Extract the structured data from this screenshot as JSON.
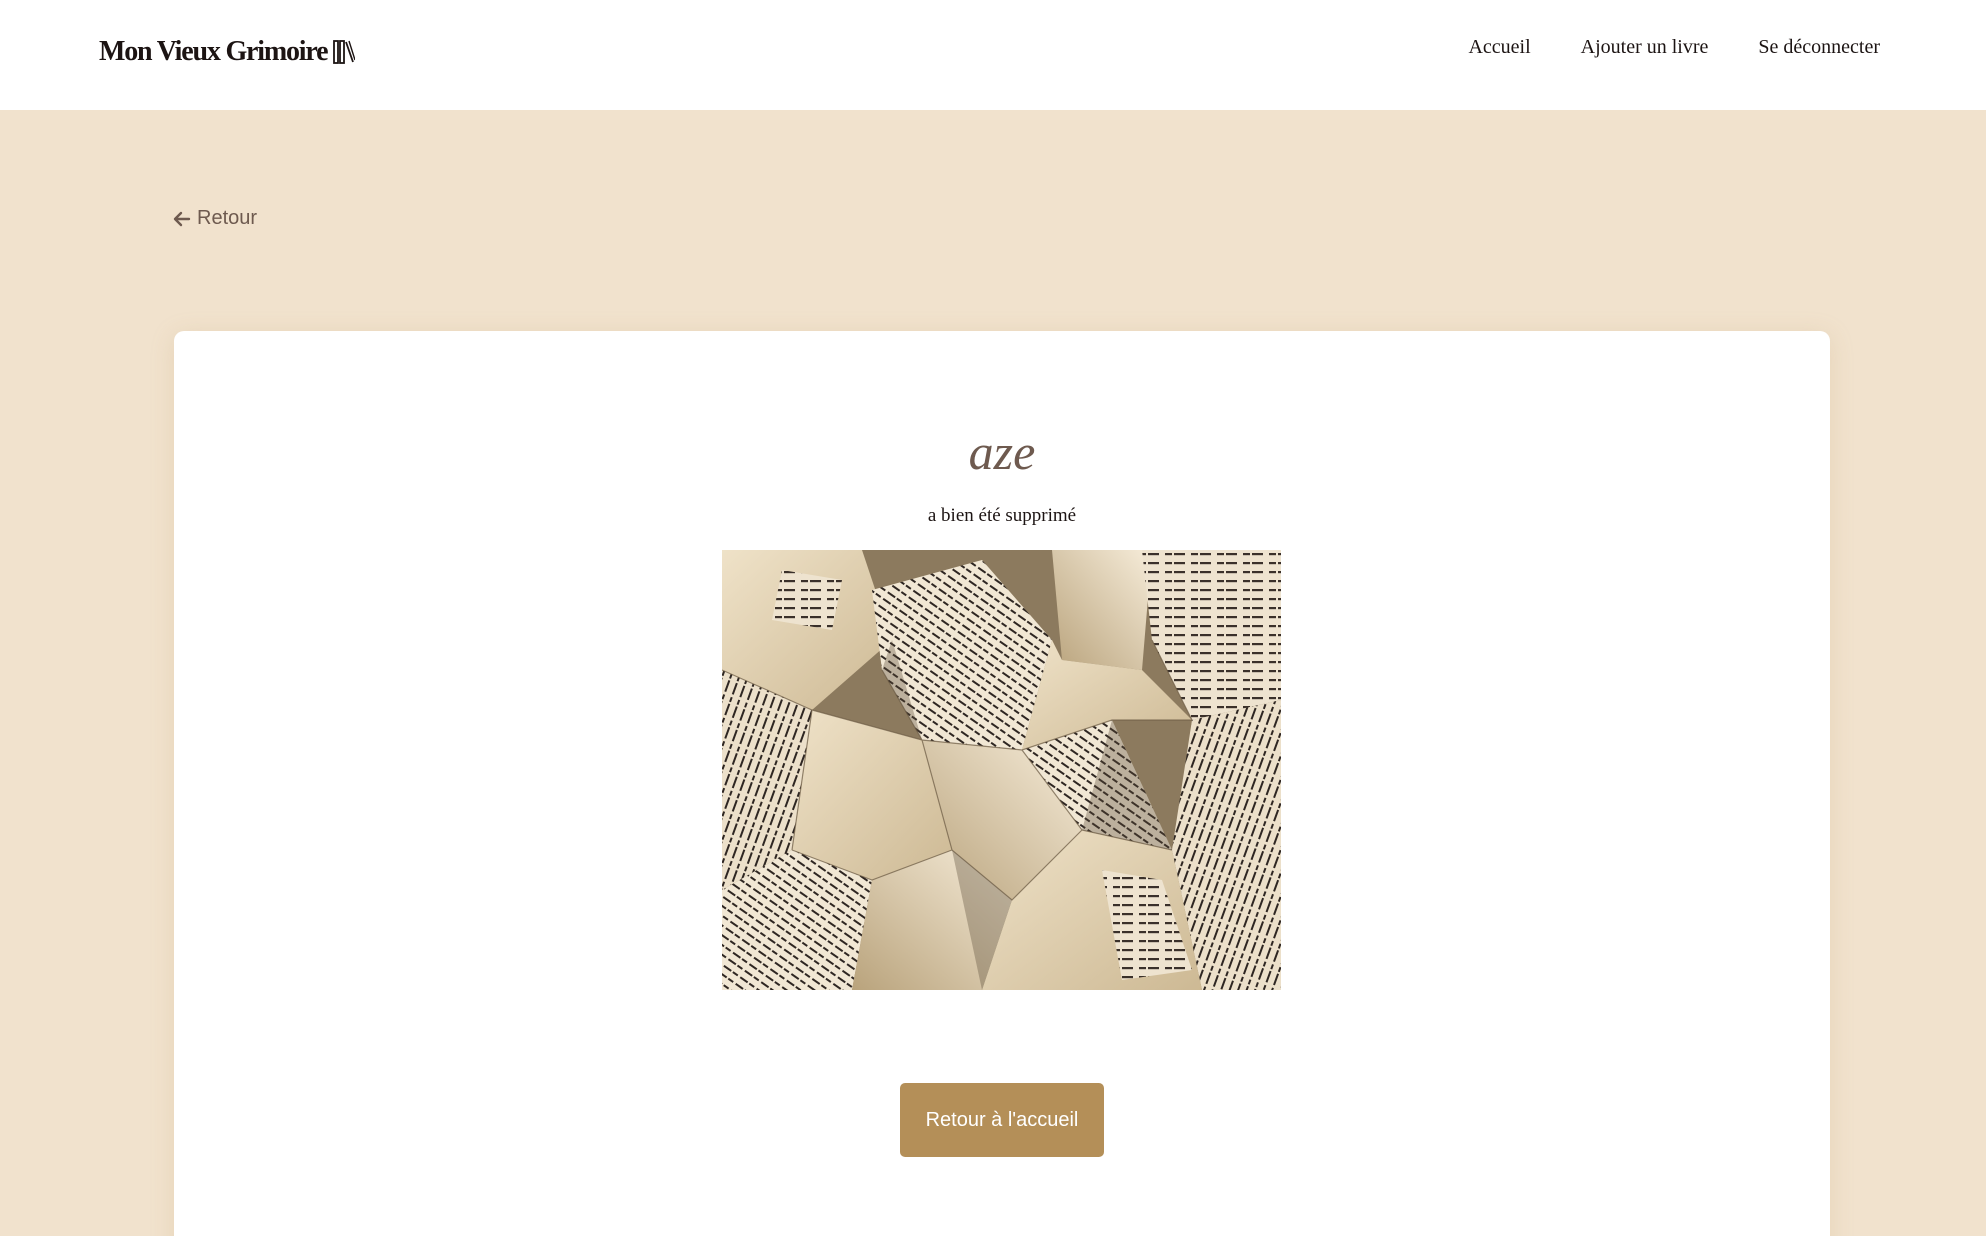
{
  "header": {
    "logo_text": "Mon Vieux Grimoire",
    "logo_icon": "books-icon",
    "nav": {
      "home_label": "Accueil",
      "add_book_label": "Ajouter un livre",
      "logout_label": "Se déconnecter"
    }
  },
  "back": {
    "icon": "arrow-left-icon",
    "label": "Retour"
  },
  "confirmation": {
    "book_title": "aze",
    "message": "a bien été supprimé",
    "image": "crumpled-book-pages-image",
    "button_label": "Retour à l'accueil"
  },
  "colors": {
    "page_background": "#f1e2cd",
    "header_background": "#ffffff",
    "card_background": "#ffffff",
    "accent_button": "#b48f58",
    "title_color": "#6e5a4f",
    "text_dark": "#1c1413"
  }
}
